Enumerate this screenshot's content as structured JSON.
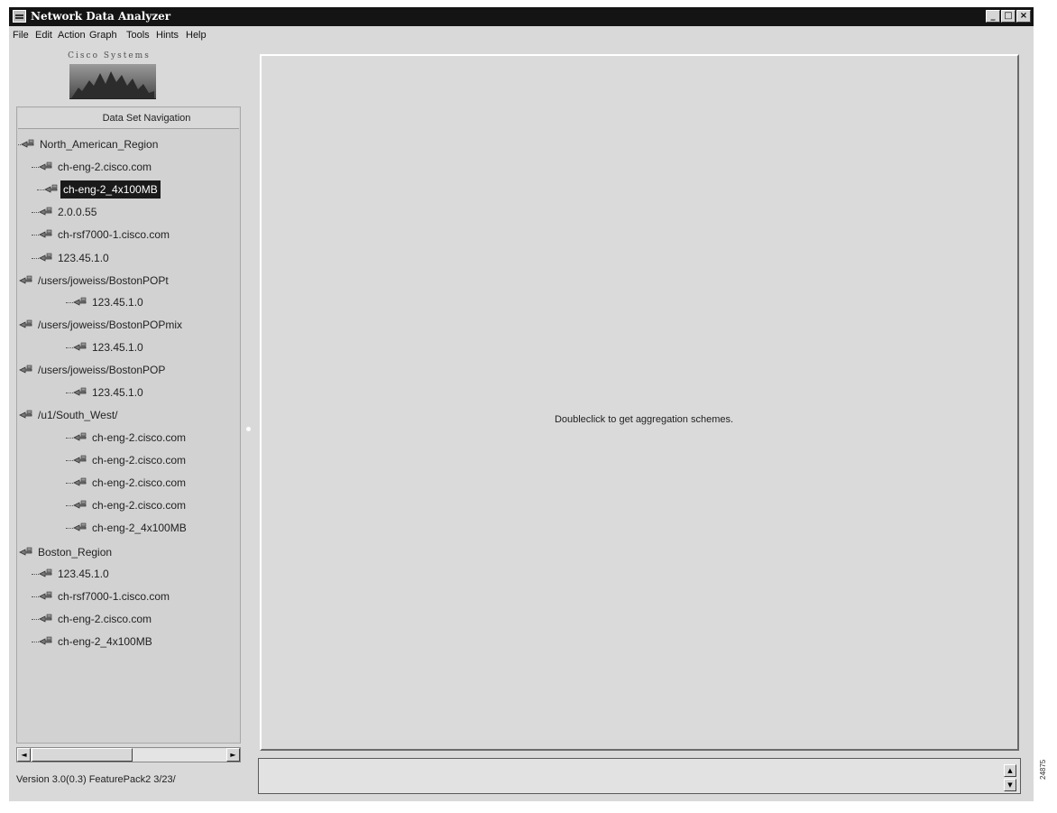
{
  "window": {
    "title": "Network Data Analyzer",
    "buttons": {
      "minimize": "_",
      "maximize": "□",
      "close": "×"
    }
  },
  "menu": [
    "File",
    "Edit",
    "Action",
    "Graph",
    "Tools",
    "Hints",
    "Help"
  ],
  "logo": {
    "text": "Cisco Systems"
  },
  "navigation": {
    "header": "Data Set Navigation",
    "items": [
      {
        "label": "North_American_Region",
        "selected": false
      },
      {
        "label": "ch-eng-2.cisco.com",
        "selected": false
      },
      {
        "label": "ch-eng-2_4x100MB",
        "selected": true
      },
      {
        "label": "2.0.0.55",
        "selected": false
      },
      {
        "label": "ch-rsf7000-1.cisco.com",
        "selected": false
      },
      {
        "label": "123.45.1.0",
        "selected": false
      },
      {
        "label": "/users/joweiss/BostonPOPt",
        "selected": false
      },
      {
        "label": "123.45.1.0",
        "selected": false
      },
      {
        "label": "/users/joweiss/BostonPOPmix",
        "selected": false
      },
      {
        "label": "123.45.1.0",
        "selected": false
      },
      {
        "label": "/users/joweiss/BostonPOP",
        "selected": false
      },
      {
        "label": "123.45.1.0",
        "selected": false
      },
      {
        "label": "/u1/South_West/",
        "selected": false
      },
      {
        "label": "ch-eng-2.cisco.com",
        "selected": false
      },
      {
        "label": "ch-eng-2.cisco.com",
        "selected": false
      },
      {
        "label": "ch-eng-2.cisco.com",
        "selected": false
      },
      {
        "label": "ch-eng-2.cisco.com",
        "selected": false
      },
      {
        "label": "ch-eng-2_4x100MB",
        "selected": false
      },
      {
        "label": "Boston_Region",
        "selected": false
      },
      {
        "label": "123.45.1.0",
        "selected": false
      },
      {
        "label": "ch-rsf7000-1.cisco.com",
        "selected": false
      },
      {
        "label": "ch-eng-2.cisco.com",
        "selected": false
      },
      {
        "label": "ch-eng-2_4x100MB",
        "selected": false
      }
    ]
  },
  "version": "Version 3.0(0.3) FeaturePack2 3/23/",
  "main": {
    "hint": "Doubleclick to get aggregation schemes."
  },
  "scroll_arrows": {
    "left": "◄",
    "right": "►",
    "up": "▲",
    "down": "▼"
  },
  "figure_id": "24875",
  "icon": "data-set-node-icon"
}
